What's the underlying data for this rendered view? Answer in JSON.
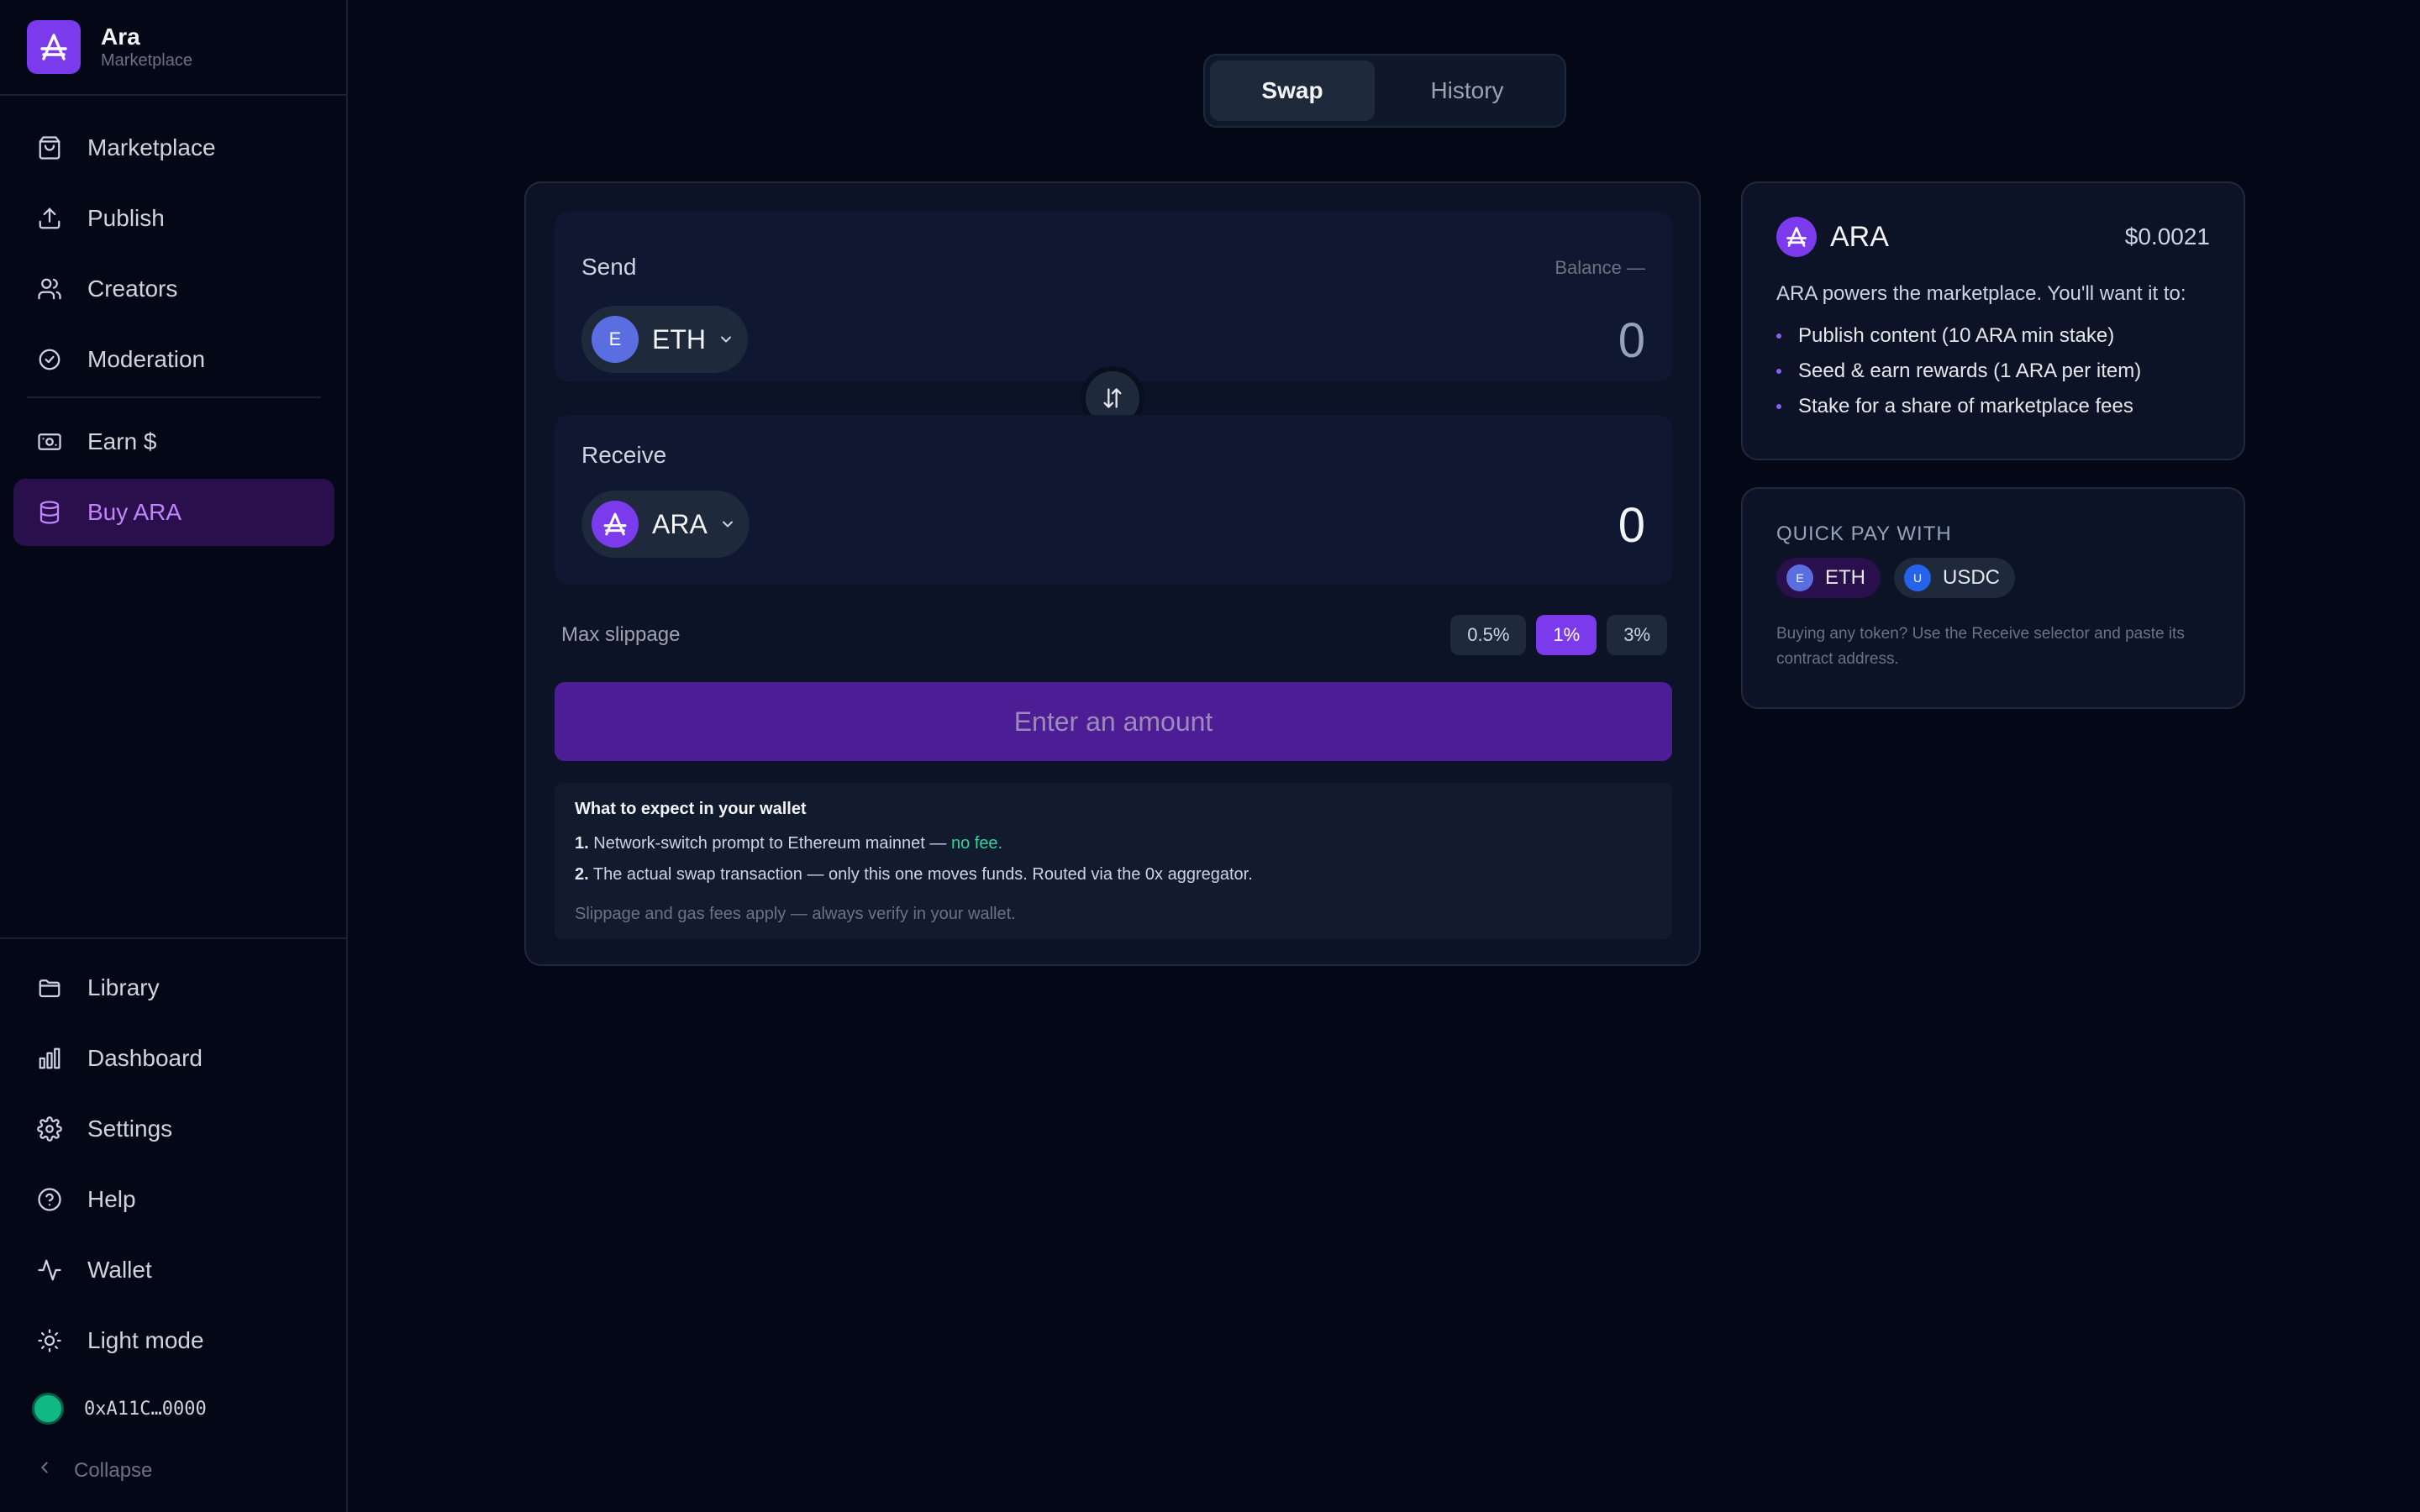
{
  "brand": {
    "name": "Ara",
    "subtitle": "Marketplace"
  },
  "sidebar": {
    "top_items": [
      {
        "label": "Marketplace",
        "icon": "shopping-bag-icon"
      },
      {
        "label": "Publish",
        "icon": "upload-icon"
      },
      {
        "label": "Creators",
        "icon": "users-icon"
      },
      {
        "label": "Moderation",
        "icon": "shield-check-icon"
      }
    ],
    "mid_items": [
      {
        "label": "Earn $",
        "icon": "banknote-icon"
      },
      {
        "label": "Buy ARA",
        "icon": "coins-icon",
        "active": true
      }
    ],
    "bottom_items": [
      {
        "label": "Library",
        "icon": "folder-icon"
      },
      {
        "label": "Dashboard",
        "icon": "bar-chart-icon"
      },
      {
        "label": "Settings",
        "icon": "gear-icon"
      },
      {
        "label": "Help",
        "icon": "help-icon"
      },
      {
        "label": "Wallet",
        "icon": "activity-icon"
      },
      {
        "label": "Light mode",
        "icon": "sun-icon"
      }
    ],
    "wallet_address": "0xA11C…0000",
    "collapse_label": "Collapse"
  },
  "tabs": [
    {
      "label": "Swap",
      "active": true
    },
    {
      "label": "History",
      "active": false
    }
  ],
  "swap": {
    "send_label": "Send",
    "balance_text": "Balance —",
    "send_token": {
      "symbol": "ETH",
      "icon_letter": "E"
    },
    "send_amount": "0",
    "receive_label": "Receive",
    "receive_token": {
      "symbol": "ARA"
    },
    "receive_amount": "0",
    "slippage_label": "Max slippage",
    "slippage_options": [
      "0.5%",
      "1%",
      "3%"
    ],
    "slippage_selected": "1%",
    "cta_label": "Enter an amount",
    "info": {
      "title": "What to expect in your wallet",
      "step1_num": "1.",
      "step1_text": "Network-switch prompt to Ethereum mainnet — ",
      "step1_highlight": "no fee.",
      "step2_num": "2.",
      "step2_text": "The actual swap transaction — only this one moves funds. Routed via the 0x aggregator.",
      "footnote": "Slippage and gas fees apply — always verify in your wallet."
    }
  },
  "ara_card": {
    "title": "ARA",
    "price": "$0.0021",
    "description": "ARA powers the marketplace. You'll want it to:",
    "bullets": [
      "Publish content (10 ARA min stake)",
      "Seed & earn rewards (1 ARA per item)",
      "Stake for a share of marketplace fees"
    ]
  },
  "quick_pay": {
    "title": "QUICK PAY WITH",
    "tokens": [
      {
        "symbol": "ETH",
        "letter": "E"
      },
      {
        "symbol": "USDC",
        "letter": "U"
      }
    ],
    "note": "Buying any token? Use the Receive selector and paste its contract address."
  },
  "colors": {
    "background": "#040716",
    "accent": "#7c3aed",
    "active_nav_bg": "#2a0f4d",
    "success": "#34d399"
  }
}
